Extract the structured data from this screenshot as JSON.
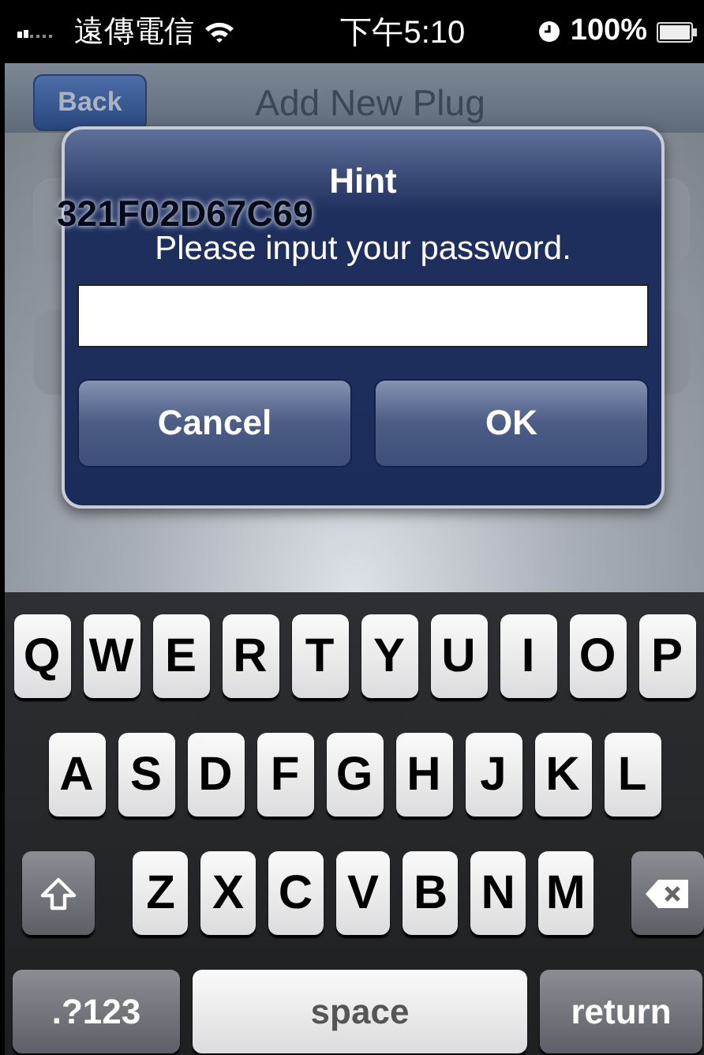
{
  "status_bar": {
    "carrier": "遠傳電信",
    "time": "下午5:10",
    "battery": "100%"
  },
  "nav_bar": {
    "back": "Back",
    "title": "Add New Plug"
  },
  "fields": [
    {
      "value": "321F02D67C69"
    }
  ],
  "dialog": {
    "title": "Hint",
    "message": "Please input your password.",
    "buttons": [
      "Cancel",
      "OK"
    ]
  },
  "keyboard": {
    "top_row": [
      {
        "kind": "letter",
        "label": "Q"
      },
      {
        "kind": "letter",
        "label": "W"
      },
      {
        "kind": "letter",
        "label": "E"
      },
      {
        "kind": "letter",
        "label": "R"
      },
      {
        "kind": "letter",
        "label": "T"
      },
      {
        "kind": "letter",
        "label": "Y"
      },
      {
        "kind": "letter",
        "label": "U"
      },
      {
        "kind": "letter",
        "label": "I"
      },
      {
        "kind": "letter",
        "label": "O"
      },
      {
        "kind": "letter",
        "label": "P"
      }
    ],
    "middle_row": [
      {
        "kind": "letter",
        "label": "A"
      },
      {
        "kind": "letter",
        "label": "S"
      },
      {
        "kind": "letter",
        "label": "D"
      },
      {
        "kind": "letter",
        "label": "F"
      },
      {
        "kind": "letter",
        "label": "G"
      },
      {
        "kind": "letter",
        "label": "H"
      },
      {
        "kind": "letter",
        "label": "J"
      },
      {
        "kind": "letter",
        "label": "K"
      },
      {
        "kind": "letter",
        "label": "L"
      }
    ],
    "bottom_row": [
      {
        "kind": "shift"
      },
      {
        "kind": "letter",
        "label": "Z"
      },
      {
        "kind": "letter",
        "label": "X"
      },
      {
        "kind": "letter",
        "label": "C"
      },
      {
        "kind": "letter",
        "label": "V"
      },
      {
        "kind": "letter",
        "label": "B"
      },
      {
        "kind": "letter",
        "label": "N"
      },
      {
        "kind": "letter",
        "label": "M"
      },
      {
        "kind": "delete"
      }
    ],
    "function_row": [
      {
        "kind": "mode",
        "label": ".?123"
      },
      {
        "kind": "space",
        "label": "space"
      },
      {
        "kind": "return",
        "label": "return"
      }
    ]
  }
}
